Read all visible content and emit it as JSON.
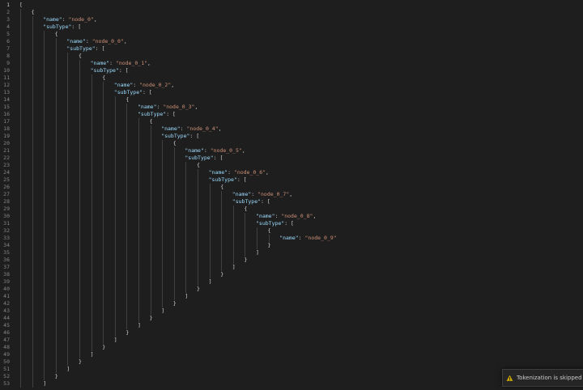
{
  "editor": {
    "theme_colors": {
      "background": "#1e1e1e",
      "line_number": "#858585",
      "key": "#9cdcfe",
      "string": "#ce9178",
      "punctuation": "#d4d4d4"
    },
    "lines": [
      {
        "n": "1",
        "indent": 0,
        "tokens": [
          {
            "t": "[",
            "c": "bracket"
          }
        ]
      },
      {
        "n": "2",
        "indent": 1,
        "tokens": [
          {
            "t": "{",
            "c": "bracket"
          }
        ]
      },
      {
        "n": "3",
        "indent": 2,
        "tokens": [
          {
            "t": "\"name\"",
            "c": "key"
          },
          {
            "t": ": ",
            "c": "punct"
          },
          {
            "t": "\"node_0\"",
            "c": "str"
          },
          {
            "t": ",",
            "c": "punct"
          }
        ]
      },
      {
        "n": "4",
        "indent": 2,
        "tokens": [
          {
            "t": "\"subType\"",
            "c": "key"
          },
          {
            "t": ": [",
            "c": "punct"
          }
        ]
      },
      {
        "n": "5",
        "indent": 3,
        "tokens": [
          {
            "t": "{",
            "c": "bracket"
          }
        ]
      },
      {
        "n": "6",
        "indent": 4,
        "tokens": [
          {
            "t": "\"name\"",
            "c": "key"
          },
          {
            "t": ": ",
            "c": "punct"
          },
          {
            "t": "\"node_0_0\"",
            "c": "str"
          },
          {
            "t": ",",
            "c": "punct"
          }
        ]
      },
      {
        "n": "7",
        "indent": 4,
        "tokens": [
          {
            "t": "\"subType\"",
            "c": "key"
          },
          {
            "t": ": [",
            "c": "punct"
          }
        ]
      },
      {
        "n": "8",
        "indent": 5,
        "tokens": [
          {
            "t": "{",
            "c": "bracket"
          }
        ]
      },
      {
        "n": "9",
        "indent": 6,
        "tokens": [
          {
            "t": "\"name\"",
            "c": "key"
          },
          {
            "t": ": ",
            "c": "punct"
          },
          {
            "t": "\"node_0_1\"",
            "c": "str"
          },
          {
            "t": ",",
            "c": "punct"
          }
        ]
      },
      {
        "n": "10",
        "indent": 6,
        "tokens": [
          {
            "t": "\"subType\"",
            "c": "key"
          },
          {
            "t": ": [",
            "c": "punct"
          }
        ]
      },
      {
        "n": "11",
        "indent": 7,
        "tokens": [
          {
            "t": "{",
            "c": "bracket"
          }
        ]
      },
      {
        "n": "12",
        "indent": 8,
        "tokens": [
          {
            "t": "\"name\"",
            "c": "key"
          },
          {
            "t": ": ",
            "c": "punct"
          },
          {
            "t": "\"node_0_2\"",
            "c": "str"
          },
          {
            "t": ",",
            "c": "punct"
          }
        ]
      },
      {
        "n": "13",
        "indent": 8,
        "tokens": [
          {
            "t": "\"subType\"",
            "c": "key"
          },
          {
            "t": ": [",
            "c": "punct"
          }
        ]
      },
      {
        "n": "14",
        "indent": 9,
        "tokens": [
          {
            "t": "{",
            "c": "bracket"
          }
        ]
      },
      {
        "n": "15",
        "indent": 10,
        "tokens": [
          {
            "t": "\"name\"",
            "c": "key"
          },
          {
            "t": ": ",
            "c": "punct"
          },
          {
            "t": "\"node_0_3\"",
            "c": "str"
          },
          {
            "t": ",",
            "c": "punct"
          }
        ]
      },
      {
        "n": "16",
        "indent": 10,
        "tokens": [
          {
            "t": "\"subType\"",
            "c": "key"
          },
          {
            "t": ": [",
            "c": "punct"
          }
        ]
      },
      {
        "n": "17",
        "indent": 11,
        "tokens": [
          {
            "t": "{",
            "c": "bracket"
          }
        ]
      },
      {
        "n": "18",
        "indent": 12,
        "tokens": [
          {
            "t": "\"name\"",
            "c": "key"
          },
          {
            "t": ": ",
            "c": "punct"
          },
          {
            "t": "\"node_0_4\"",
            "c": "str"
          },
          {
            "t": ",",
            "c": "punct"
          }
        ]
      },
      {
        "n": "19",
        "indent": 12,
        "tokens": [
          {
            "t": "\"subType\"",
            "c": "key"
          },
          {
            "t": ": [",
            "c": "punct"
          }
        ]
      },
      {
        "n": "20",
        "indent": 13,
        "tokens": [
          {
            "t": "{",
            "c": "bracket"
          }
        ]
      },
      {
        "n": "21",
        "indent": 14,
        "tokens": [
          {
            "t": "\"name\"",
            "c": "key"
          },
          {
            "t": ": ",
            "c": "punct"
          },
          {
            "t": "\"node_0_5\"",
            "c": "str"
          },
          {
            "t": ",",
            "c": "punct"
          }
        ]
      },
      {
        "n": "22",
        "indent": 14,
        "tokens": [
          {
            "t": "\"subType\"",
            "c": "key"
          },
          {
            "t": ": [",
            "c": "punct"
          }
        ]
      },
      {
        "n": "23",
        "indent": 15,
        "tokens": [
          {
            "t": "{",
            "c": "bracket"
          }
        ]
      },
      {
        "n": "24",
        "indent": 16,
        "tokens": [
          {
            "t": "\"name\"",
            "c": "key"
          },
          {
            "t": ": ",
            "c": "punct"
          },
          {
            "t": "\"node_0_6\"",
            "c": "str"
          },
          {
            "t": ",",
            "c": "punct"
          }
        ]
      },
      {
        "n": "25",
        "indent": 16,
        "tokens": [
          {
            "t": "\"subType\"",
            "c": "key"
          },
          {
            "t": ": [",
            "c": "punct"
          }
        ]
      },
      {
        "n": "26",
        "indent": 17,
        "tokens": [
          {
            "t": "{",
            "c": "bracket"
          }
        ]
      },
      {
        "n": "27",
        "indent": 18,
        "tokens": [
          {
            "t": "\"name\"",
            "c": "key"
          },
          {
            "t": ": ",
            "c": "punct"
          },
          {
            "t": "\"node_0_7\"",
            "c": "str"
          },
          {
            "t": ",",
            "c": "punct"
          }
        ]
      },
      {
        "n": "28",
        "indent": 18,
        "tokens": [
          {
            "t": "\"subType\"",
            "c": "key"
          },
          {
            "t": ": [",
            "c": "punct"
          }
        ]
      },
      {
        "n": "29",
        "indent": 19,
        "tokens": [
          {
            "t": "{",
            "c": "bracket"
          }
        ]
      },
      {
        "n": "30",
        "indent": 20,
        "tokens": [
          {
            "t": "\"name\"",
            "c": "key"
          },
          {
            "t": ": ",
            "c": "punct"
          },
          {
            "t": "\"node_0_8\"",
            "c": "str"
          },
          {
            "t": ",",
            "c": "punct"
          }
        ]
      },
      {
        "n": "31",
        "indent": 20,
        "tokens": [
          {
            "t": "\"subType\"",
            "c": "key"
          },
          {
            "t": ": [",
            "c": "punct"
          }
        ]
      },
      {
        "n": "32",
        "indent": 21,
        "tokens": [
          {
            "t": "{",
            "c": "bracket"
          }
        ]
      },
      {
        "n": "33",
        "indent": 22,
        "tokens": [
          {
            "t": "\"name\"",
            "c": "key"
          },
          {
            "t": ": ",
            "c": "punct"
          },
          {
            "t": "\"node_0_9\"",
            "c": "str"
          }
        ]
      },
      {
        "n": "34",
        "indent": 21,
        "tokens": [
          {
            "t": "}",
            "c": "bracket"
          }
        ]
      },
      {
        "n": "35",
        "indent": 20,
        "tokens": [
          {
            "t": "]",
            "c": "bracket"
          }
        ]
      },
      {
        "n": "36",
        "indent": 19,
        "tokens": [
          {
            "t": "}",
            "c": "bracket"
          }
        ]
      },
      {
        "n": "37",
        "indent": 18,
        "tokens": [
          {
            "t": "]",
            "c": "bracket"
          }
        ]
      },
      {
        "n": "38",
        "indent": 17,
        "tokens": [
          {
            "t": "}",
            "c": "bracket"
          }
        ]
      },
      {
        "n": "39",
        "indent": 16,
        "tokens": [
          {
            "t": "]",
            "c": "bracket"
          }
        ]
      },
      {
        "n": "40",
        "indent": 15,
        "tokens": [
          {
            "t": "}",
            "c": "bracket"
          }
        ]
      },
      {
        "n": "41",
        "indent": 14,
        "tokens": [
          {
            "t": "]",
            "c": "bracket"
          }
        ]
      },
      {
        "n": "42",
        "indent": 13,
        "tokens": [
          {
            "t": "}",
            "c": "bracket"
          }
        ]
      },
      {
        "n": "43",
        "indent": 12,
        "tokens": [
          {
            "t": "]",
            "c": "bracket"
          }
        ]
      },
      {
        "n": "44",
        "indent": 11,
        "tokens": [
          {
            "t": "}",
            "c": "bracket"
          }
        ]
      },
      {
        "n": "45",
        "indent": 10,
        "tokens": [
          {
            "t": "]",
            "c": "bracket"
          }
        ]
      },
      {
        "n": "46",
        "indent": 9,
        "tokens": [
          {
            "t": "}",
            "c": "bracket"
          }
        ]
      },
      {
        "n": "47",
        "indent": 8,
        "tokens": [
          {
            "t": "]",
            "c": "bracket"
          }
        ]
      },
      {
        "n": "48",
        "indent": 7,
        "tokens": [
          {
            "t": "}",
            "c": "bracket"
          }
        ]
      },
      {
        "n": "49",
        "indent": 6,
        "tokens": [
          {
            "t": "]",
            "c": "bracket"
          }
        ]
      },
      {
        "n": "50",
        "indent": 5,
        "tokens": [
          {
            "t": "}",
            "c": "bracket"
          }
        ]
      },
      {
        "n": "51",
        "indent": 4,
        "tokens": [
          {
            "t": "]",
            "c": "bracket"
          }
        ]
      },
      {
        "n": "52",
        "indent": 3,
        "tokens": [
          {
            "t": "}",
            "c": "bracket"
          }
        ]
      },
      {
        "n": "53",
        "indent": 2,
        "tokens": [
          {
            "t": "]",
            "c": "bracket"
          }
        ]
      }
    ]
  },
  "notification": {
    "icon": "warning-icon",
    "text": "Tokenization is skipped for long"
  }
}
